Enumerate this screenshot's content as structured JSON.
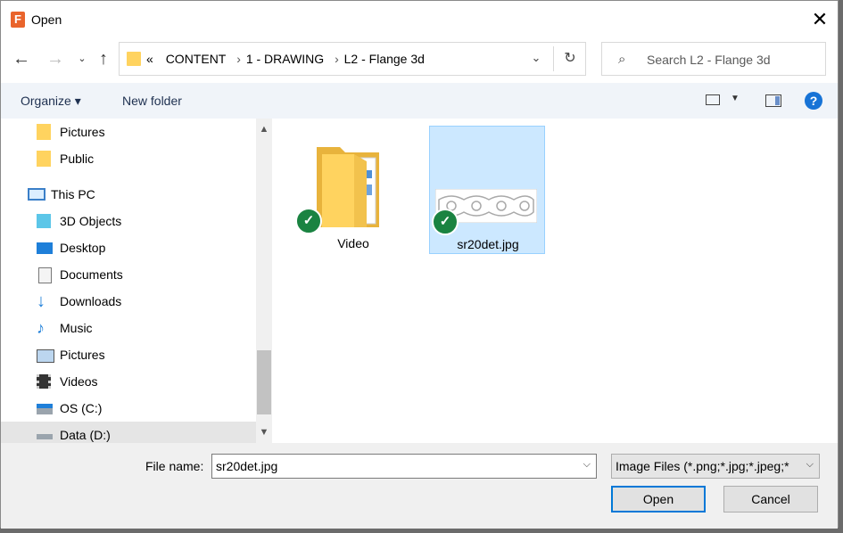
{
  "window": {
    "title": "Open",
    "app_icon_letter": "F"
  },
  "address": {
    "overflow": "«",
    "crumbs": [
      "CONTENT",
      "1 - DRAWING",
      "L2 - Flange 3d"
    ]
  },
  "search": {
    "placeholder": "Search L2 - Flange 3d"
  },
  "toolbar": {
    "organize_label": "Organize ▾",
    "new_folder_label": "New folder"
  },
  "sidebar": {
    "items": [
      {
        "label": "Pictures",
        "icon": "folder-icon"
      },
      {
        "label": "Public",
        "icon": "folder-icon"
      },
      {
        "label": "This PC",
        "icon": "computer-icon"
      },
      {
        "label": "3D Objects",
        "icon": "cube-icon"
      },
      {
        "label": "Desktop",
        "icon": "desktop-icon"
      },
      {
        "label": "Documents",
        "icon": "document-icon"
      },
      {
        "label": "Downloads",
        "icon": "download-icon"
      },
      {
        "label": "Music",
        "icon": "music-icon"
      },
      {
        "label": "Pictures",
        "icon": "pictures-icon"
      },
      {
        "label": "Videos",
        "icon": "film-icon"
      },
      {
        "label": "OS (C:)",
        "icon": "os-drive-icon"
      },
      {
        "label": "Data (D:)",
        "icon": "drive-icon"
      }
    ]
  },
  "files": [
    {
      "name": "Video",
      "type": "folder",
      "synced": true,
      "selected": false
    },
    {
      "name": "sr20det.jpg",
      "type": "image",
      "synced": true,
      "selected": true
    }
  ],
  "footer": {
    "filename_label": "File name:",
    "filename_value": "sr20det.jpg",
    "filter_value": "Image Files (*.png;*.jpg;*.jpeg;*",
    "open_label": "Open",
    "cancel_label": "Cancel"
  },
  "colors": {
    "accent": "#0078d7",
    "sync_check": "#1a8341",
    "selection": "#cce8ff",
    "folder": "#ffd35f"
  }
}
